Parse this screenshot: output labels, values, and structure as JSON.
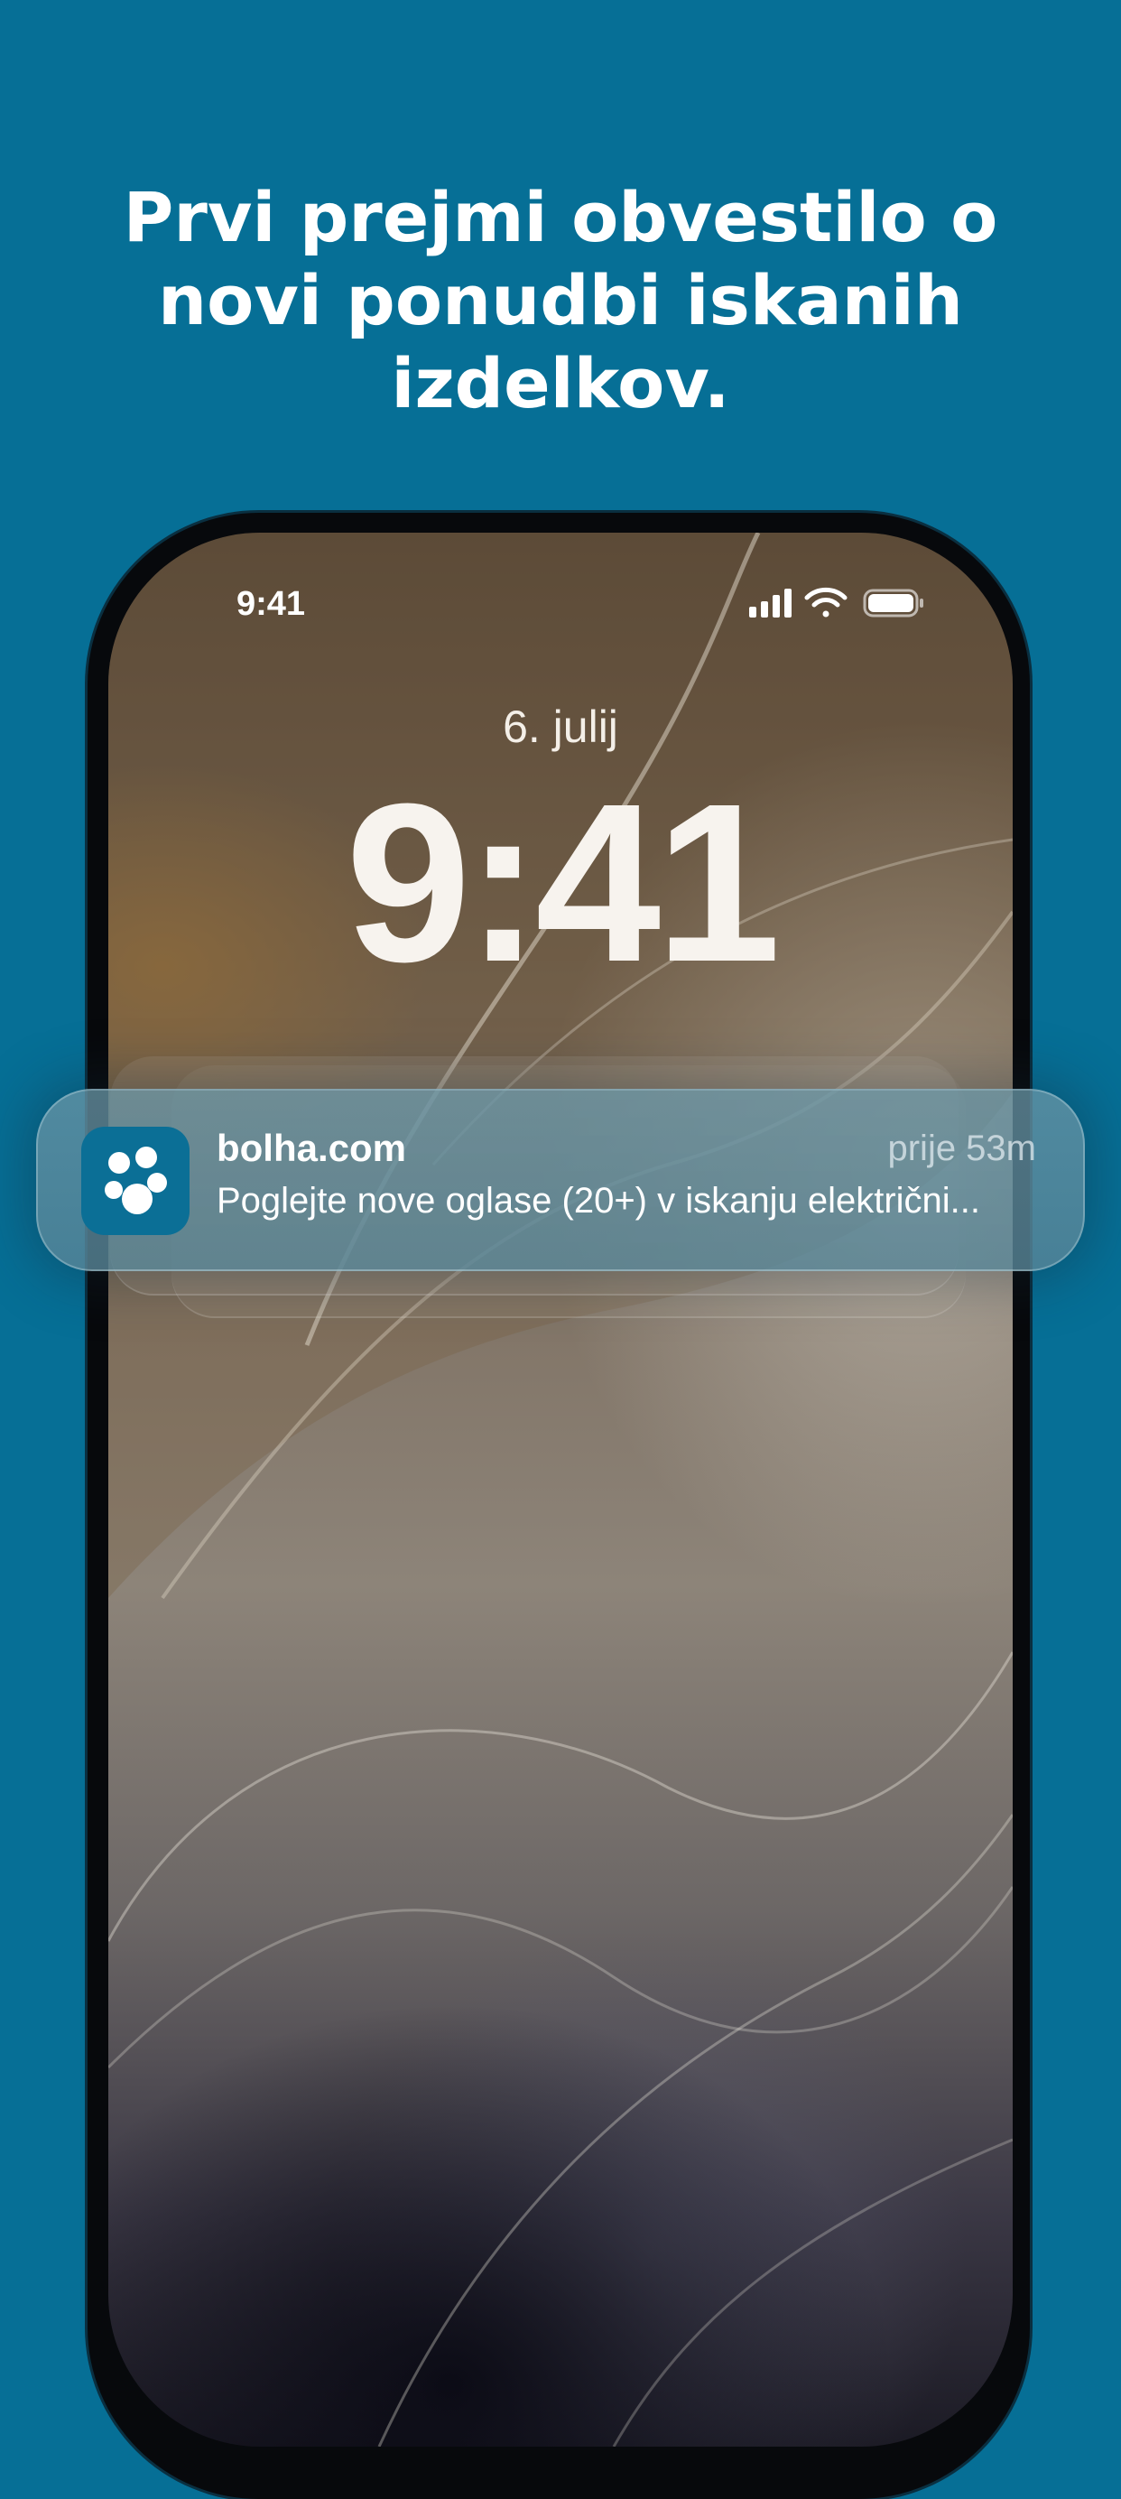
{
  "headline": {
    "line1": "Prvi prejmi obvestilo o",
    "line2": "novi ponudbi iskanih",
    "line3": "izdelkov."
  },
  "status_bar": {
    "time": "9:41",
    "icons": [
      "cellular-signal-icon",
      "wifi-icon",
      "battery-icon"
    ]
  },
  "lock_screen": {
    "date": "6. julij",
    "clock": "9:41"
  },
  "notification": {
    "app_icon": "bolha-paw-icon",
    "app_name": "bolha.com",
    "time": "prije 53m",
    "body": "Poglejte nove oglase (20+) v iskanju električni..."
  },
  "colors": {
    "background": "#066f96",
    "app_icon": "#0b6f96",
    "text": "#ffffff"
  }
}
